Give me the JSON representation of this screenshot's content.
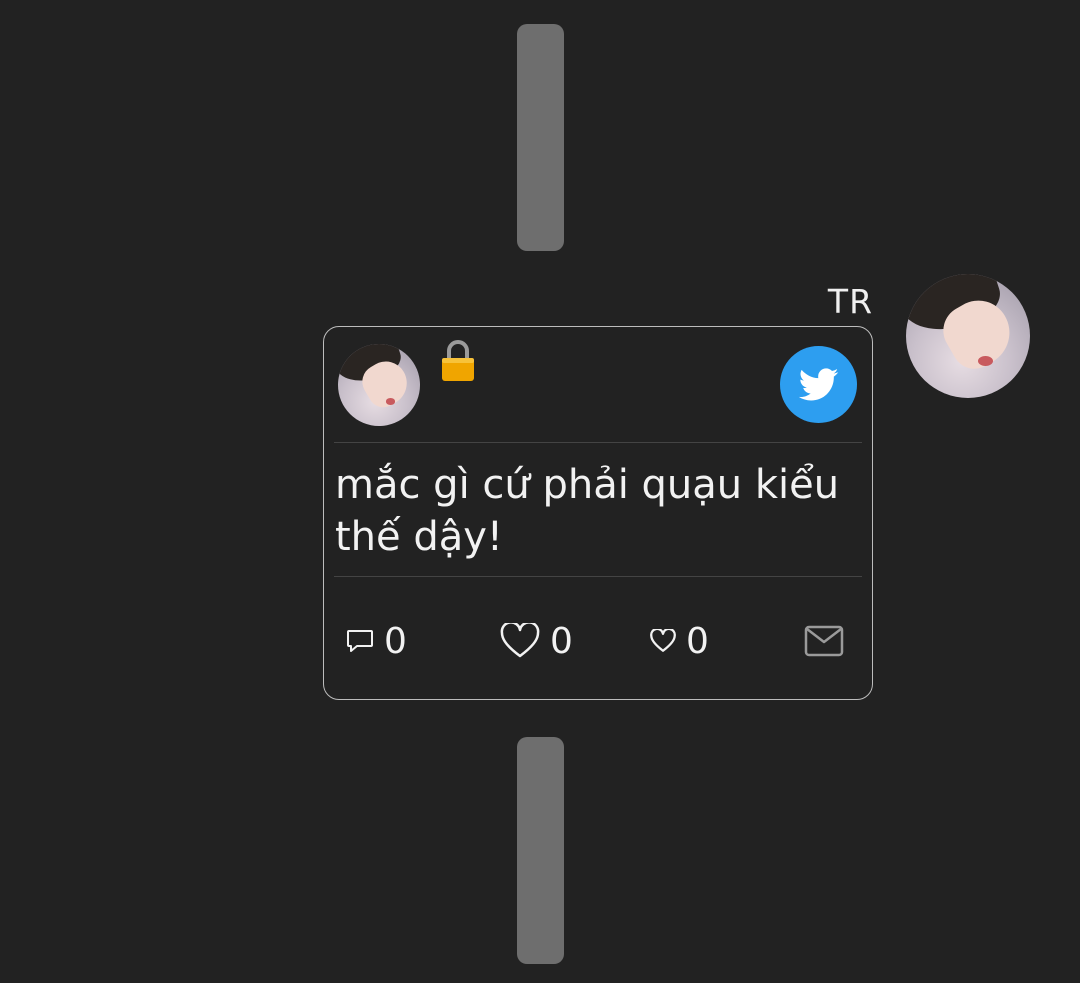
{
  "chat": {
    "sender_name": "TR",
    "sender_avatar": "avatar",
    "message": {
      "type": "tweet-card",
      "platform_icon": "twitter-icon",
      "platform_color": "#2d9ef0",
      "lock_icon": "lock-icon",
      "text": "mắc gì cứ phải quạu kiểu thế dậy!",
      "actions": {
        "reply_icon": "comment-icon",
        "reply_count": "0",
        "like_icon": "heart-icon",
        "like_count": "0",
        "secondary_like_icon": "small-heart-icon",
        "secondary_like_count": "0",
        "message_icon": "mail-icon"
      }
    }
  },
  "colors": {
    "background": "#222222",
    "placeholder": "#6e6e6e",
    "card_border": "#bdbdbd",
    "lock": "#f0a500"
  }
}
